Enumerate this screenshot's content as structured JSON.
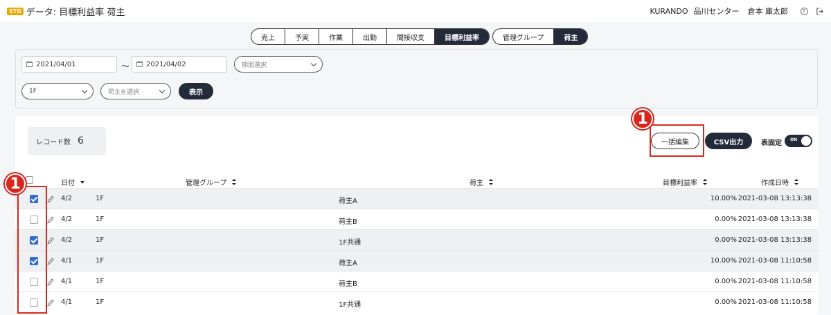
{
  "header": {
    "badge": "STG",
    "title": "データ: 目標利益率 荷主",
    "company": "KURANDO",
    "center": "品川センター",
    "user": "倉本 庫太郎",
    "help_icon": "help-circle-icon",
    "logout_icon": "logout-icon"
  },
  "tabs": {
    "group1": [
      "売上",
      "予実",
      "作業",
      "出勤",
      "間接収支",
      "目標利益率"
    ],
    "group2": [
      "管理グループ",
      "荷主"
    ],
    "active_group1": "目標利益率",
    "active_group2": "荷主"
  },
  "filters": {
    "date_from": "2021/04/01",
    "date_sep": "～",
    "date_to": "2021/04/02",
    "period_placeholder": "期間選択",
    "floor": "1F",
    "shipper_placeholder": "荷主を選択",
    "show_label": "表示"
  },
  "toolbar": {
    "record_label": "レコード数",
    "record_count": "6",
    "bulk_edit_label": "一括編集",
    "csv_label": "CSV出力",
    "fix_label": "表固定",
    "toggle_label": "ON"
  },
  "table": {
    "headers": {
      "date": "日付",
      "group": "管理グループ",
      "shipper": "荷主",
      "rate": "目標利益率",
      "created": "作成日時"
    },
    "rows": [
      {
        "checked": true,
        "date": "4/2",
        "group": "1F",
        "shipper": "荷主A",
        "rate": "10.00%",
        "created": "2021-03-08 13:13:38"
      },
      {
        "checked": false,
        "date": "4/2",
        "group": "1F",
        "shipper": "荷主B",
        "rate": "0.00%",
        "created": "2021-03-08 13:13:38"
      },
      {
        "checked": true,
        "date": "4/2",
        "group": "1F",
        "shipper": "1F共通",
        "rate": "0.00%",
        "created": "2021-03-08 13:13:38"
      },
      {
        "checked": true,
        "date": "4/1",
        "group": "1F",
        "shipper": "荷主A",
        "rate": "10.00%",
        "created": "2021-03-08 11:10:58"
      },
      {
        "checked": false,
        "date": "4/1",
        "group": "1F",
        "shipper": "荷主B",
        "rate": "0.00%",
        "created": "2021-03-08 11:10:58"
      },
      {
        "checked": false,
        "date": "4/1",
        "group": "1F",
        "shipper": "1F共通",
        "rate": "0.00%",
        "created": "2021-03-08 11:10:58"
      }
    ]
  },
  "annotations": {
    "badge_number": "1",
    "color": "#d9261c"
  }
}
